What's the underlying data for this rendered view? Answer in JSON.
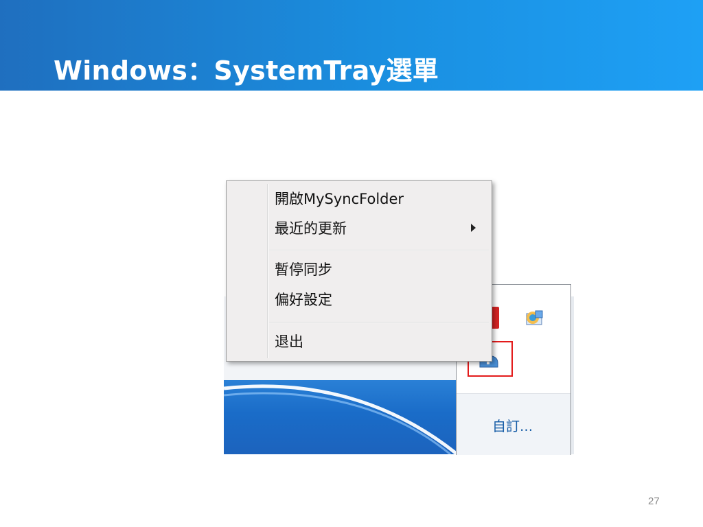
{
  "slide": {
    "title": "Windows：SystemTray選單",
    "page_number": "27"
  },
  "context_menu": {
    "items": [
      {
        "label": "開啟MySyncFolder",
        "has_submenu": false
      },
      {
        "label": "最近的更新",
        "has_submenu": true
      },
      {
        "label": "暫停同步",
        "has_submenu": false
      },
      {
        "label": "偏好設定",
        "has_submenu": false
      },
      {
        "label": "退出",
        "has_submenu": false
      }
    ]
  },
  "tray_overflow": {
    "customize_link": "自訂...",
    "icons": [
      "red-app-icon",
      "network-globe-icon",
      "mysyncfolder-icon"
    ],
    "highlighted_icon": "mysyncfolder-icon"
  },
  "colors": {
    "header_gradient_start": "#1f6fbf",
    "header_gradient_end": "#1ea0f5",
    "highlight_box": "#e31b1b",
    "link": "#1a5fa8"
  }
}
